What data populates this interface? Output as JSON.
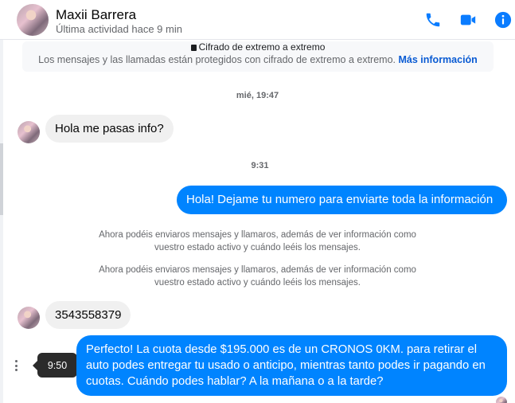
{
  "header": {
    "name": "Maxii Barrera",
    "status": "Última actividad hace 9 min"
  },
  "encryption": {
    "title": "Cifrado de extremo a extremo",
    "text": "Los mensajes y las llamadas están protegidos con cifrado de extremo a extremo.",
    "link": "Más información"
  },
  "messages": {
    "ts1": "mié, 19:47",
    "m1": "Hola me pasas info?",
    "ts2": "9:31",
    "m2": "Hola! Dejame tu numero  para enviarte toda la información",
    "sys1_line1": "Ahora podéis enviaros mensajes y llamaros, además de ver información como",
    "sys1_line2": "vuestro estado activo y cuándo leéis los mensajes.",
    "sys2_line1": "Ahora podéis enviaros mensajes y llamaros, además de ver información como",
    "sys2_line2": "vuestro estado activo y cuándo leéis los mensajes.",
    "m3": "3543558379",
    "m4": "Perfecto! La cuota desde $195.000 es de un CRONOS 0KM. para retirar el auto podes entregar tu usado o anticipo, mientras tanto podes ir pagando en cuotas. Cuándo podes hablar? A la mañana o a la tarde?",
    "tooltip": "9:50"
  },
  "colors": {
    "accent": "#0084ff",
    "icon_blue": "#0a7cff",
    "incoming_bg": "#f0f0f0"
  },
  "icons": {
    "call": "phone-icon",
    "video": "video-camera-icon",
    "info": "info-icon",
    "more": "more-vertical-icon",
    "lock": "lock-icon"
  }
}
